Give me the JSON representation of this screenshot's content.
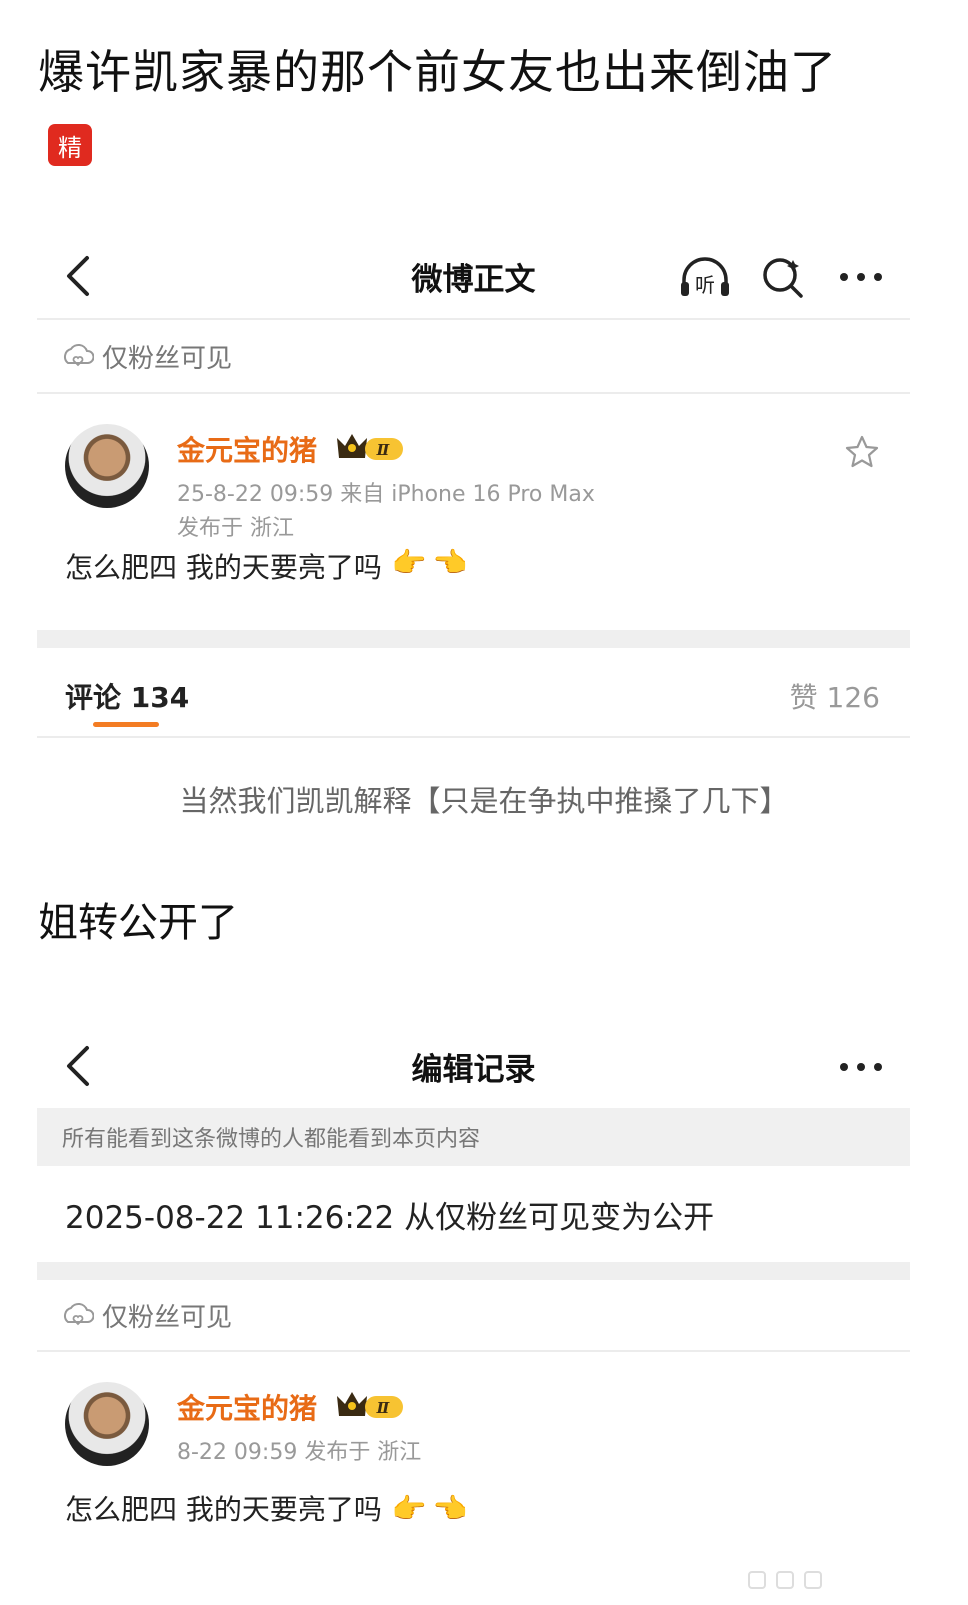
{
  "post": {
    "title": "爆许凯家暴的那个前女友也出来倒油了",
    "badge": "精",
    "mid_text": "姐转公开了"
  },
  "screenshot1": {
    "nav_title": "微博正文",
    "listen_icon_label": "听",
    "visibility": "仅粉丝可见",
    "username": "金元宝的猪",
    "vip_level": "Ⅱ",
    "timestamp_source": "25-8-22 09:59  来自 iPhone 16 Pro Max",
    "location": "发布于 浙江",
    "content": "怎么肥四 我的天要亮了吗",
    "emoji": [
      "👉",
      "👈"
    ],
    "comments_label": "评论 134",
    "likes_label": "赞 126",
    "caption": "当然我们凯凯解释【只是在争执中推搡了几下】"
  },
  "screenshot2": {
    "nav_title": "编辑记录",
    "notice": "所有能看到这条微博的人都能看到本页内容",
    "edit_record": "2025-08-22 11:26:22 从仅粉丝可见变为公开",
    "visibility": "仅粉丝可见",
    "username": "金元宝的猪",
    "vip_level": "Ⅱ",
    "meta": "8-22 09:59  发布于 浙江",
    "content": "怎么肥四 我的天要亮了吗",
    "emoji": [
      "👉",
      "👈"
    ]
  },
  "colors": {
    "accent_orange": "#e86b16",
    "badge_red": "#e02a1f",
    "underline_orange": "#f37c23"
  }
}
